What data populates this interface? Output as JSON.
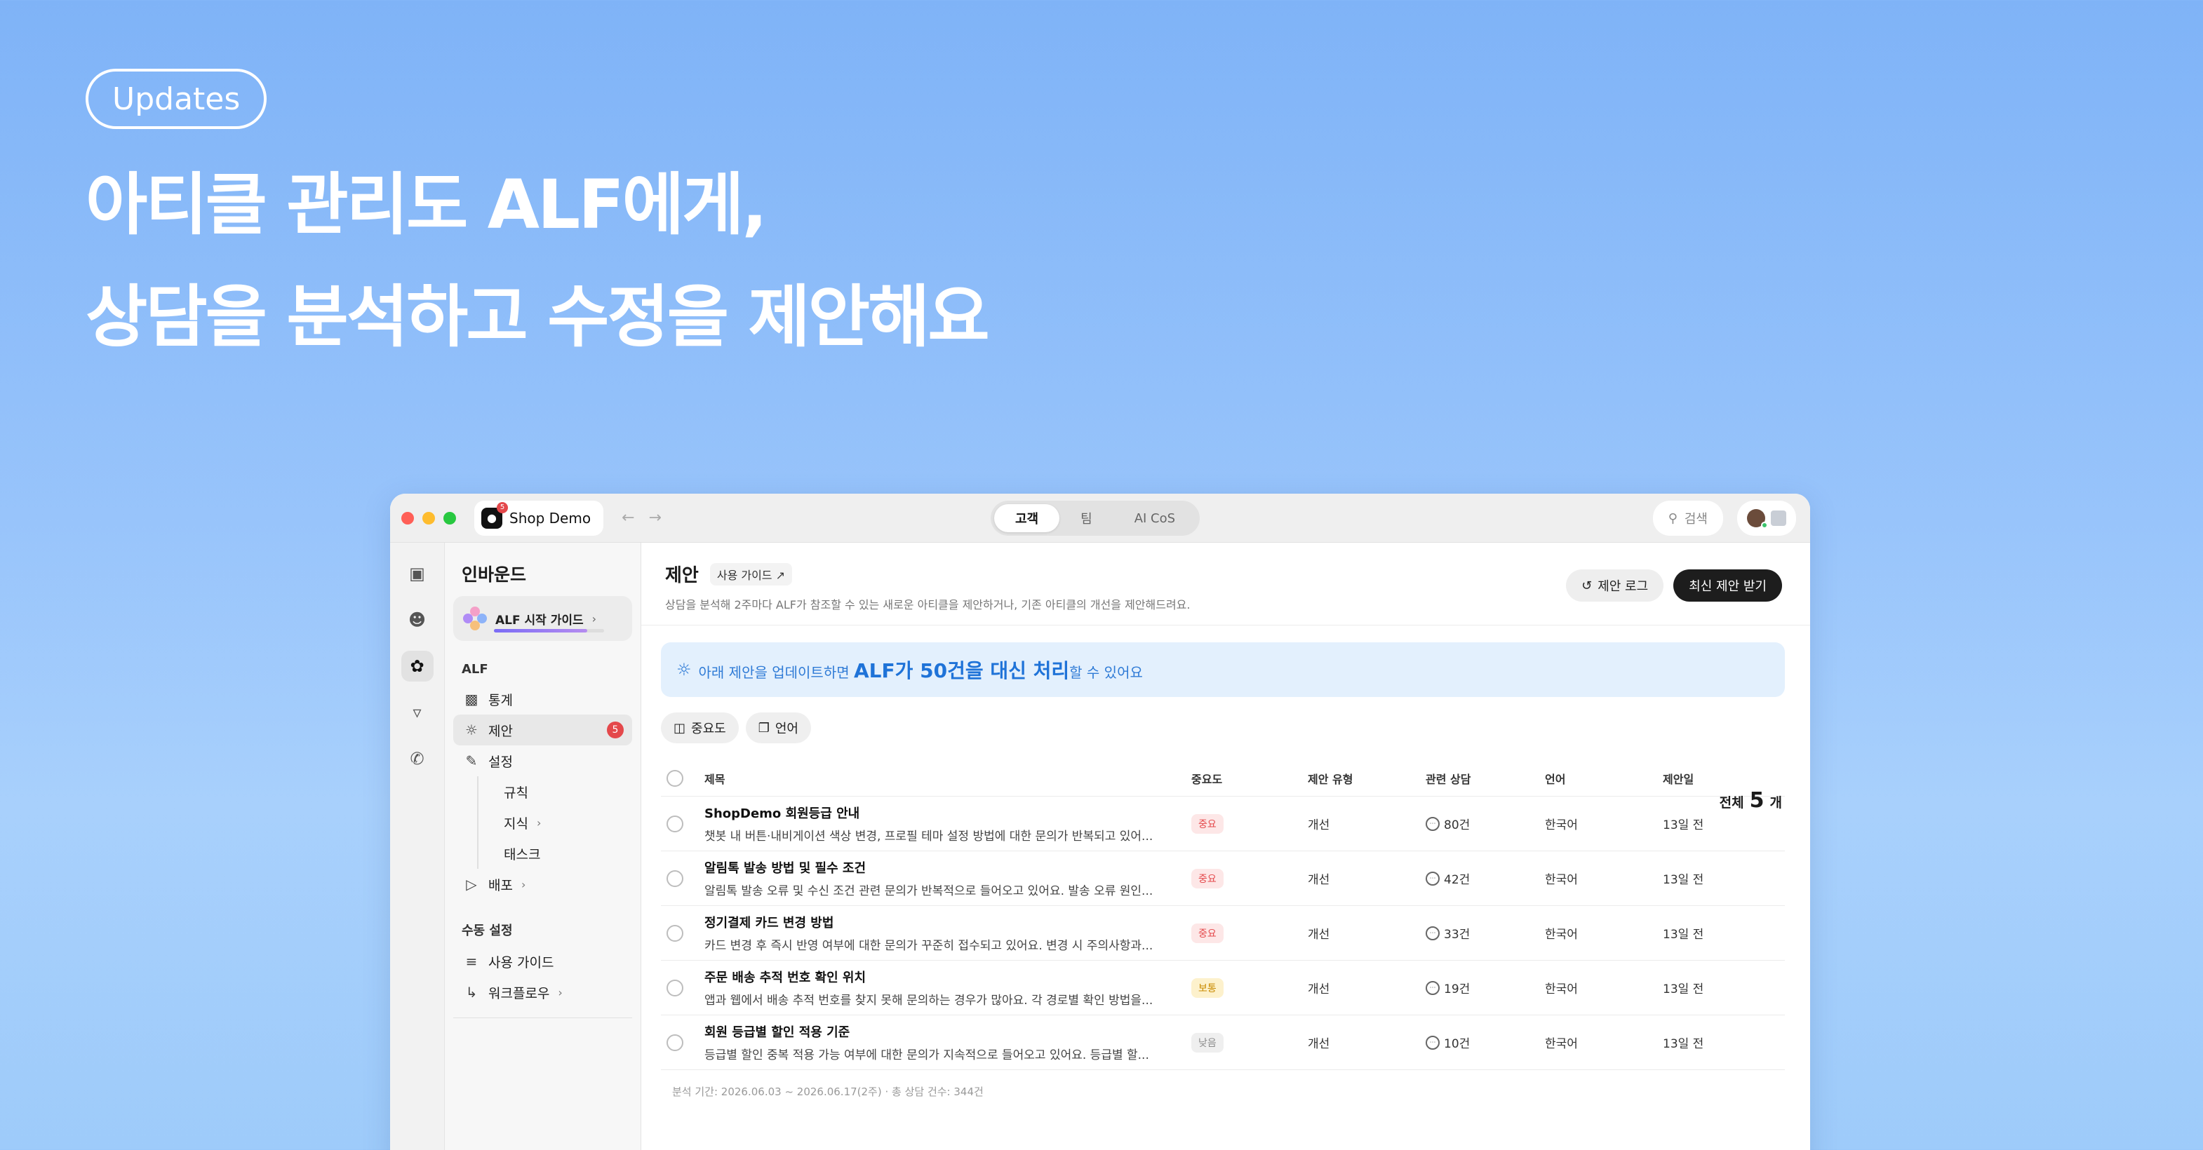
{
  "hero": {
    "pill": "Updates",
    "line1": "아티클 관리도 ALF에게,",
    "line2": "상담을 분석하고 수정을 제안해요"
  },
  "titlebar": {
    "app_name": "Shop Demo",
    "app_badge": "5",
    "tabs": [
      "고객",
      "팀",
      "AI CoS"
    ],
    "active_tab": "고객",
    "search_label": "검색"
  },
  "sidebar": {
    "title": "인바운드",
    "guide_label": "ALF 시작 가이드",
    "guide_progress": 0.85,
    "section_alf": "ALF",
    "items": {
      "stats": "통계",
      "suggest": "제안",
      "suggest_badge": "5",
      "settings": "설정",
      "rules": "규칙",
      "knowledge": "지식",
      "tasks": "태스크",
      "deploy": "배포"
    },
    "section_manual": "수동 설정",
    "manual_items": {
      "guide": "사용 가이드",
      "workflow": "워크플로우"
    }
  },
  "main": {
    "title": "제안",
    "guide_link": "사용 가이드 ↗",
    "description": "상담을 분석해 2주마다 ALF가 참조할 수 있는 새로운 아티클을 제안하거나, 기존 아티클의 개선을 제안해드려요.",
    "log_button": "제안 로그",
    "latest_button": "최신 제안 받기",
    "banner": {
      "prefix": "아래 제안을 업데이트하면 ",
      "highlight": "ALF가 50건을 대신 처리",
      "suffix": "할 수 있어요"
    },
    "filters": [
      "중요도",
      "언어"
    ],
    "total_label": "전체",
    "total_count": "5",
    "total_unit": "개",
    "columns": [
      "제목",
      "중요도",
      "제안 유형",
      "관련 상담",
      "언어",
      "제안일"
    ],
    "rows": [
      {
        "title": "ShopDemo 회원등급 안내",
        "desc": "챗봇 내 버튼·내비게이션 색상 변경, 프로필 테마 설정 방법에 대한 문의가 반복되고 있어...",
        "importance": "중요",
        "type": "개선",
        "count": "80건",
        "lang": "한국어",
        "date": "13일 전"
      },
      {
        "title": "알림톡 발송 방법 및 필수 조건",
        "desc": "알림톡 발송 오류 및 수신 조건 관련 문의가 반복적으로 들어오고 있어요. 발송 오류 원인...",
        "importance": "중요",
        "type": "개선",
        "count": "42건",
        "lang": "한국어",
        "date": "13일 전"
      },
      {
        "title": "정기결제 카드 변경 방법",
        "desc": "카드 변경 후 즉시 반영 여부에 대한 문의가 꾸준히 접수되고 있어요. 변경 시 주의사항과...",
        "importance": "중요",
        "type": "개선",
        "count": "33건",
        "lang": "한국어",
        "date": "13일 전"
      },
      {
        "title": "주문 배송 추적 번호 확인 위치",
        "desc": "앱과 웹에서 배송 추적 번호를 찾지 못해 문의하는 경우가 많아요. 각 경로별 확인 방법을...",
        "importance": "보통",
        "type": "개선",
        "count": "19건",
        "lang": "한국어",
        "date": "13일 전"
      },
      {
        "title": "회원 등급별 할인 적용 기준",
        "desc": "등급별 할인 중복 적용 가능 여부에 대한 문의가 지속적으로 들어오고 있어요. 등급별 할...",
        "importance": "낮음",
        "type": "개선",
        "count": "10건",
        "lang": "한국어",
        "date": "13일 전"
      }
    ],
    "footer": "분석 기간: 2026.06.03 ~ 2026.06.17(2주) · 총 상담 건수: 344건"
  },
  "colors": {
    "important": "#e4484b",
    "normal": "#c98a00",
    "low": "#8a8a8a",
    "accent": "#1f73d8"
  }
}
